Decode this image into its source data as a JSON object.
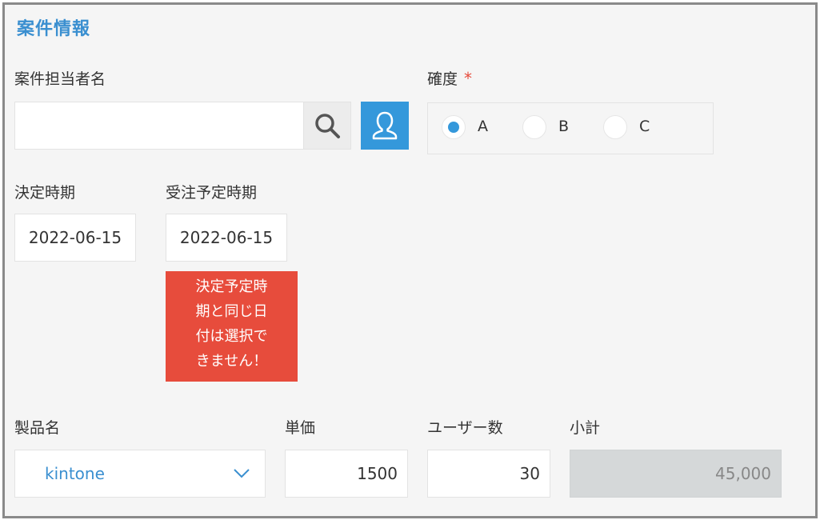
{
  "section": {
    "title": "案件情報"
  },
  "fields": {
    "assignee": {
      "label": "案件担当者名",
      "value": ""
    },
    "certainty": {
      "label": "確度",
      "required_mark": "*",
      "options": [
        "A",
        "B",
        "C"
      ],
      "selected": "A"
    },
    "decision_date": {
      "label": "決定時期",
      "value": "2022-06-15"
    },
    "order_date": {
      "label": "受注予定時期",
      "value": "2022-06-15",
      "error_lines": [
        "決定予定時",
        "期と同じ日",
        "付は選択で",
        "きません！"
      ]
    },
    "product": {
      "label": "製品名",
      "value": "kintone"
    },
    "unit_price": {
      "label": "単価",
      "value": "1500"
    },
    "users": {
      "label": "ユーザー数",
      "value": "30"
    },
    "subtotal": {
      "label": "小計",
      "value": "45,000"
    }
  },
  "colors": {
    "accent": "#3498db",
    "error": "#e74c3c",
    "title": "#3a8fd0"
  },
  "icons": [
    "search-icon",
    "user-icon",
    "chevron-down-icon"
  ]
}
